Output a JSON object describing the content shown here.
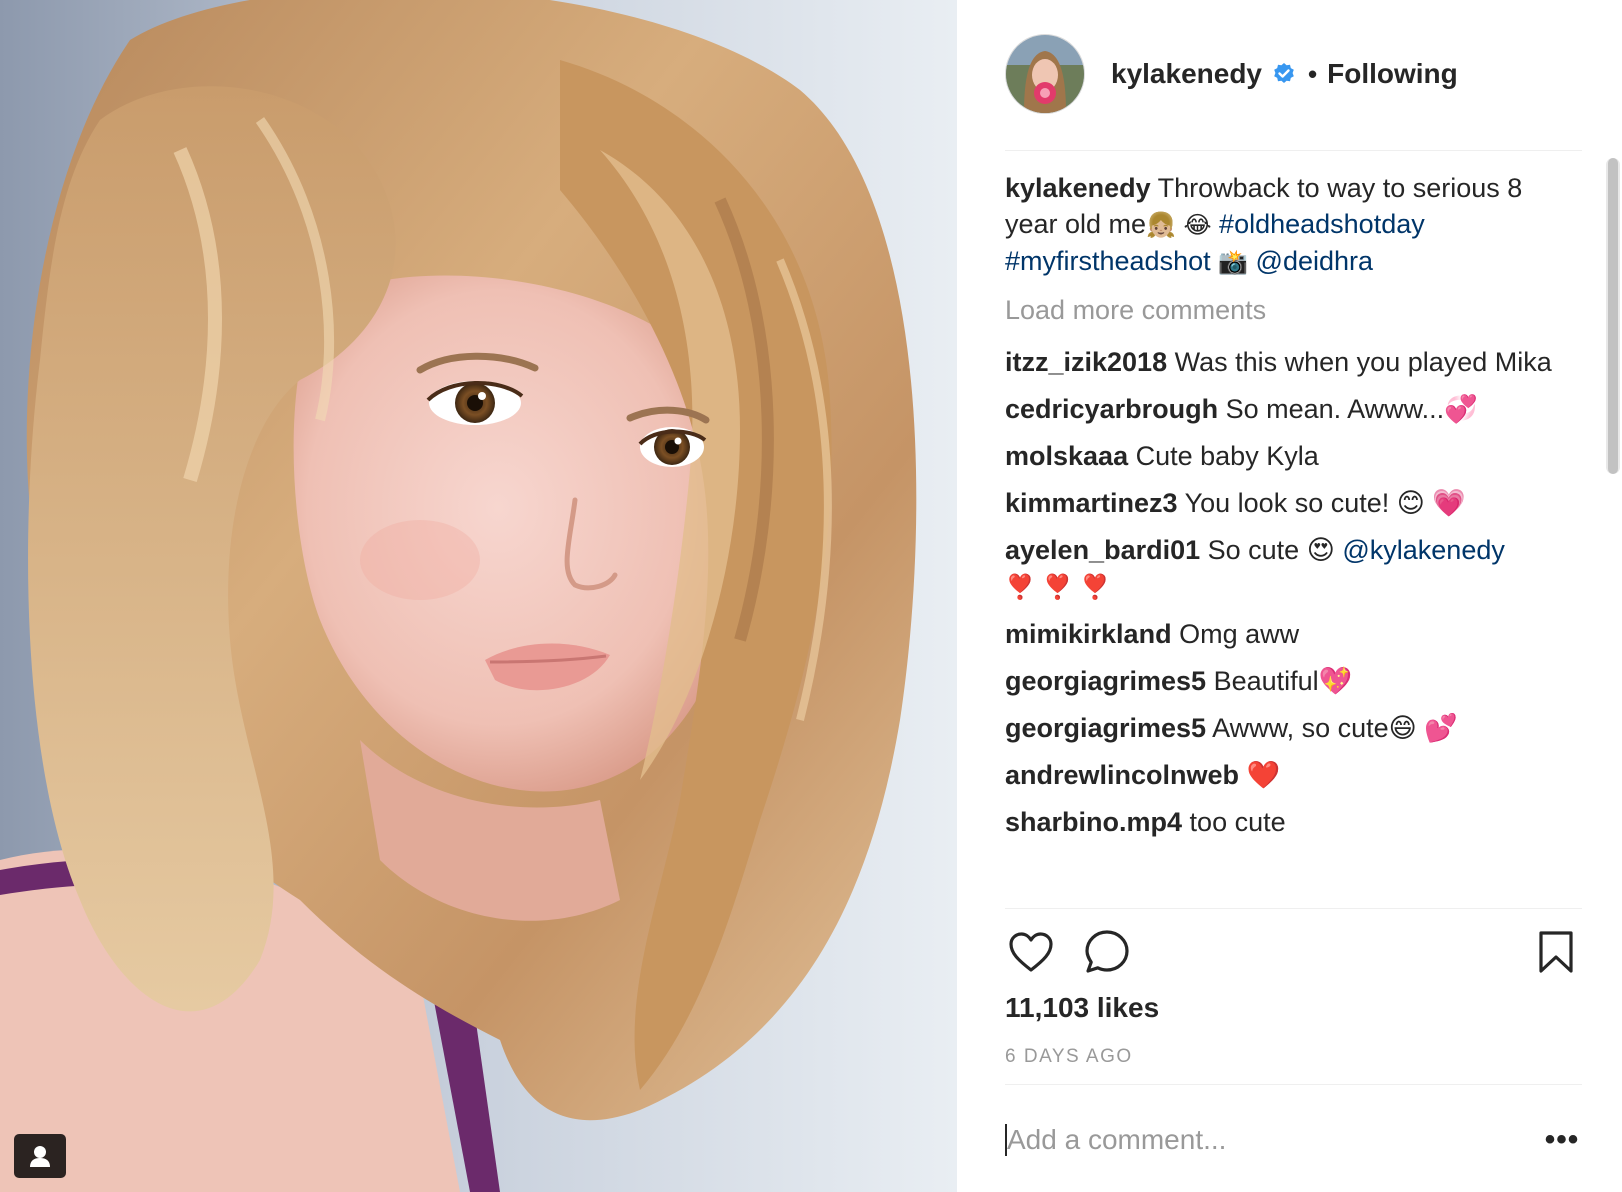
{
  "post": {
    "author": "kylakenedy",
    "follow_status": "Following",
    "separator": "•",
    "likes": "11,103 likes",
    "time_ago": "6 DAYS AGO",
    "comment_placeholder": "Add a comment...",
    "more_label": "•••"
  },
  "caption": {
    "user": "kylakenedy",
    "text": "Throwback to way to serious 8 year old me",
    "emoji1": "👧🏼",
    "emoji2": "😂",
    "tag1": "#oldheadshotday",
    "tag2": "#myfirstheadshot",
    "emoji3": "📸",
    "mention": "@deidhra"
  },
  "load_more": "Load more comments",
  "comments": [
    {
      "user": "itzz_izik2018",
      "text": "Was this when you played Mika"
    },
    {
      "user": "cedricyarbrough",
      "text": "So mean. Awww...💞"
    },
    {
      "user": "molskaaa",
      "text": "Cute baby Kyla"
    },
    {
      "user": "kimmartinez3",
      "text": "You look so cute! 😊 💗"
    },
    {
      "user": "ayelen_bardi01",
      "text": "So cute 😍 ",
      "mention": "@kylakenedy",
      "trail": "❣️ ❣️ ❣️"
    },
    {
      "user": "mimikirkland",
      "text": "Omg aww"
    },
    {
      "user": "georgiagrimes5",
      "text": "Beautiful💖"
    },
    {
      "user": "georgiagrimes5",
      "text": "Awww, so cute😄 💕"
    },
    {
      "user": "andrewlincolnweb",
      "text": "❤️"
    },
    {
      "user": "sharbino.mp4",
      "text": "too cute"
    }
  ],
  "icons": {
    "like": "heart-icon",
    "comment": "comment-bubble-icon",
    "save": "bookmark-icon",
    "verified": "verified-badge-icon",
    "tag": "user-tag-icon"
  },
  "colors": {
    "text": "#262626",
    "link": "#003569",
    "muted": "#999999",
    "verified": "#3897f0"
  }
}
